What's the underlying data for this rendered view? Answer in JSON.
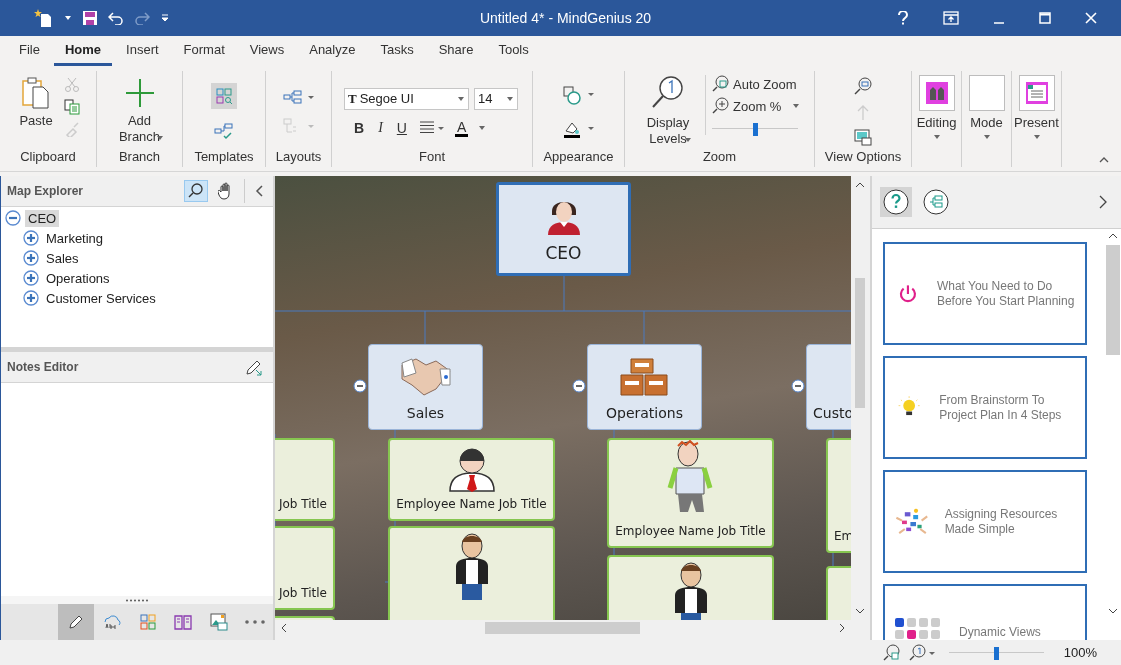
{
  "window": {
    "title": "Untitled 4* - MindGenius 20"
  },
  "menu_tabs": [
    {
      "label": "File",
      "selected": false
    },
    {
      "label": "Home",
      "selected": true
    },
    {
      "label": "Insert",
      "selected": false
    },
    {
      "label": "Format",
      "selected": false
    },
    {
      "label": "Views",
      "selected": false
    },
    {
      "label": "Analyze",
      "selected": false
    },
    {
      "label": "Tasks",
      "selected": false
    },
    {
      "label": "Share",
      "selected": false
    },
    {
      "label": "Tools",
      "selected": false
    }
  ],
  "ribbon": {
    "clipboard": {
      "title": "Clipboard",
      "paste": "Paste"
    },
    "branch": {
      "title": "Branch",
      "add_branch": "Add Branch"
    },
    "templates": {
      "title": "Templates"
    },
    "layouts": {
      "title": "Layouts"
    },
    "font": {
      "title": "Font",
      "family_icon": "T",
      "family": "Segoe UI",
      "size": "14",
      "bold": "B",
      "italic": "I",
      "underline": "U",
      "font_color": "A"
    },
    "appearance": {
      "title": "Appearance"
    },
    "zoom": {
      "title": "Zoom",
      "display_levels": "Display Levels",
      "auto_zoom": "Auto Zoom",
      "zoom_percent": "Zoom %",
      "level": 0.5
    },
    "view_options": {
      "title": "View Options"
    },
    "modes": [
      {
        "label": "Editing"
      },
      {
        "label": "Mode"
      },
      {
        "label": "Present"
      }
    ]
  },
  "map_explorer": {
    "title": "Map Explorer",
    "tree": [
      {
        "label": "CEO",
        "expanded": true,
        "selected": true,
        "children": [
          {
            "label": "Marketing",
            "expanded": false,
            "selected": false
          },
          {
            "label": "Sales",
            "expanded": false,
            "selected": false
          },
          {
            "label": "Operations",
            "expanded": false,
            "selected": false
          },
          {
            "label": "Customer Services",
            "expanded": false,
            "selected": false
          }
        ]
      }
    ]
  },
  "notes_editor": {
    "title": "Notes Editor"
  },
  "canvas": {
    "root": {
      "label": "CEO"
    },
    "branches": [
      {
        "label": "Sales"
      },
      {
        "label": "Operations"
      },
      {
        "label": "Custo"
      }
    ],
    "employees": [
      {
        "label": "Job Title"
      },
      {
        "label": "Job Title"
      },
      {
        "label": "Employee Name Job Title"
      },
      {
        "label": "Employee Name Job Title"
      },
      {
        "label": "Em"
      }
    ]
  },
  "help_cards": [
    {
      "title": "What You Need to Do Before You Start Planning"
    },
    {
      "title": "From Brainstorm To Project Plan In 4 Steps"
    },
    {
      "title": "Assigning Resources Made Simple"
    },
    {
      "title": "Dynamic Views"
    }
  ],
  "status_bar": {
    "zoom": "100%",
    "level": 0.5
  }
}
